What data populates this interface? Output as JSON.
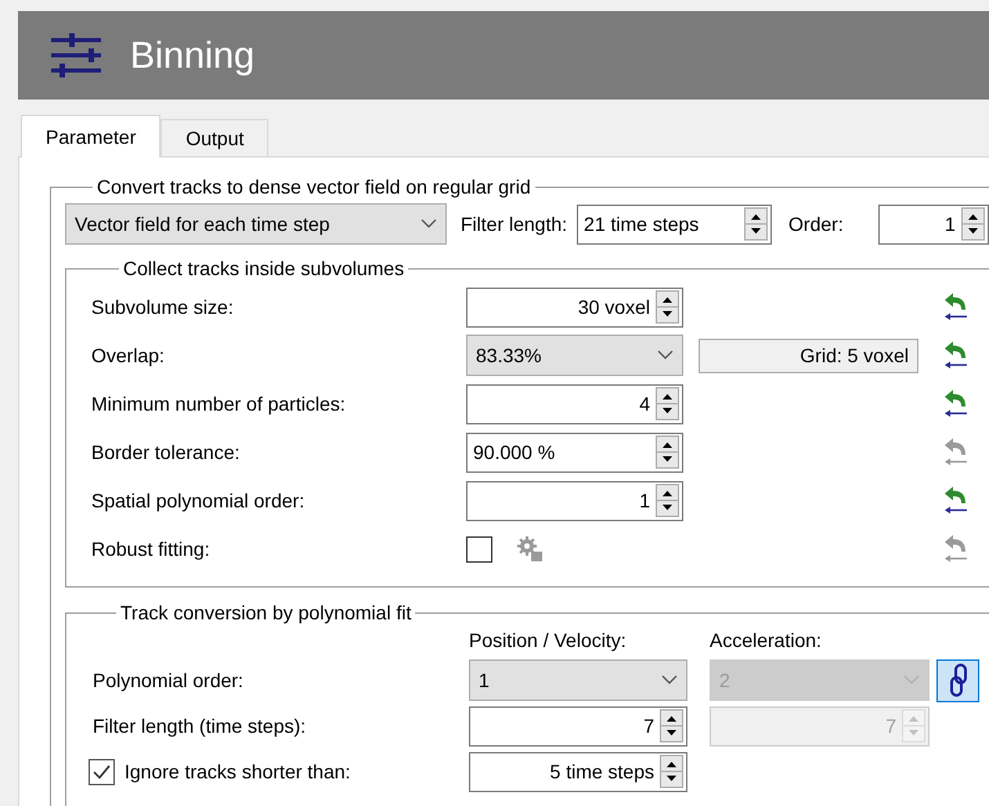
{
  "title": "Binning",
  "tabs": [
    {
      "label": "Parameter",
      "selected": true
    },
    {
      "label": "Output",
      "selected": false
    }
  ],
  "vector_field": {
    "legend": "Convert tracks to dense vector field on regular grid",
    "mode": "Vector field for each time step",
    "filter_length": {
      "label": "Filter length:",
      "value": "21 time steps"
    },
    "order": {
      "label": "Order:",
      "value": "1"
    }
  },
  "subvolumes": {
    "legend": "Collect tracks inside subvolumes",
    "rows": [
      {
        "kind": "spin",
        "label": "Subvolume size:",
        "value": "30 voxel",
        "reset_enabled": true
      },
      {
        "kind": "combo",
        "label": "Overlap:",
        "value": "83.33%",
        "info": "Grid: 5 voxel",
        "reset_enabled": true
      },
      {
        "kind": "spin",
        "label": "Minimum number of particles:",
        "value": "4",
        "reset_enabled": true
      },
      {
        "kind": "percent",
        "label": "Border tolerance:",
        "value": "90.000 %",
        "reset_enabled": false
      },
      {
        "kind": "spin",
        "label": "Spatial polynomial order:",
        "value": "1",
        "reset_enabled": true
      },
      {
        "kind": "checkbox",
        "label": "Robust fitting:",
        "checked": false,
        "options_enabled": false,
        "reset_enabled": false
      }
    ]
  },
  "polynomial_fit": {
    "legend": "Track conversion by polynomial fit",
    "columns": [
      "Position / Velocity:",
      "Acceleration:"
    ],
    "rows": [
      {
        "kind": "combo",
        "label": "Polynomial order:",
        "value": "1",
        "second": {
          "value": "2",
          "disabled": true
        },
        "linked": true
      },
      {
        "kind": "spin",
        "label": "Filter length (time steps):",
        "value": "7",
        "second": {
          "value": "7",
          "disabled": true
        }
      },
      {
        "kind": "check_spin",
        "label": "Ignore tracks shorter than:",
        "checked": true,
        "value": "5 time steps"
      }
    ]
  }
}
